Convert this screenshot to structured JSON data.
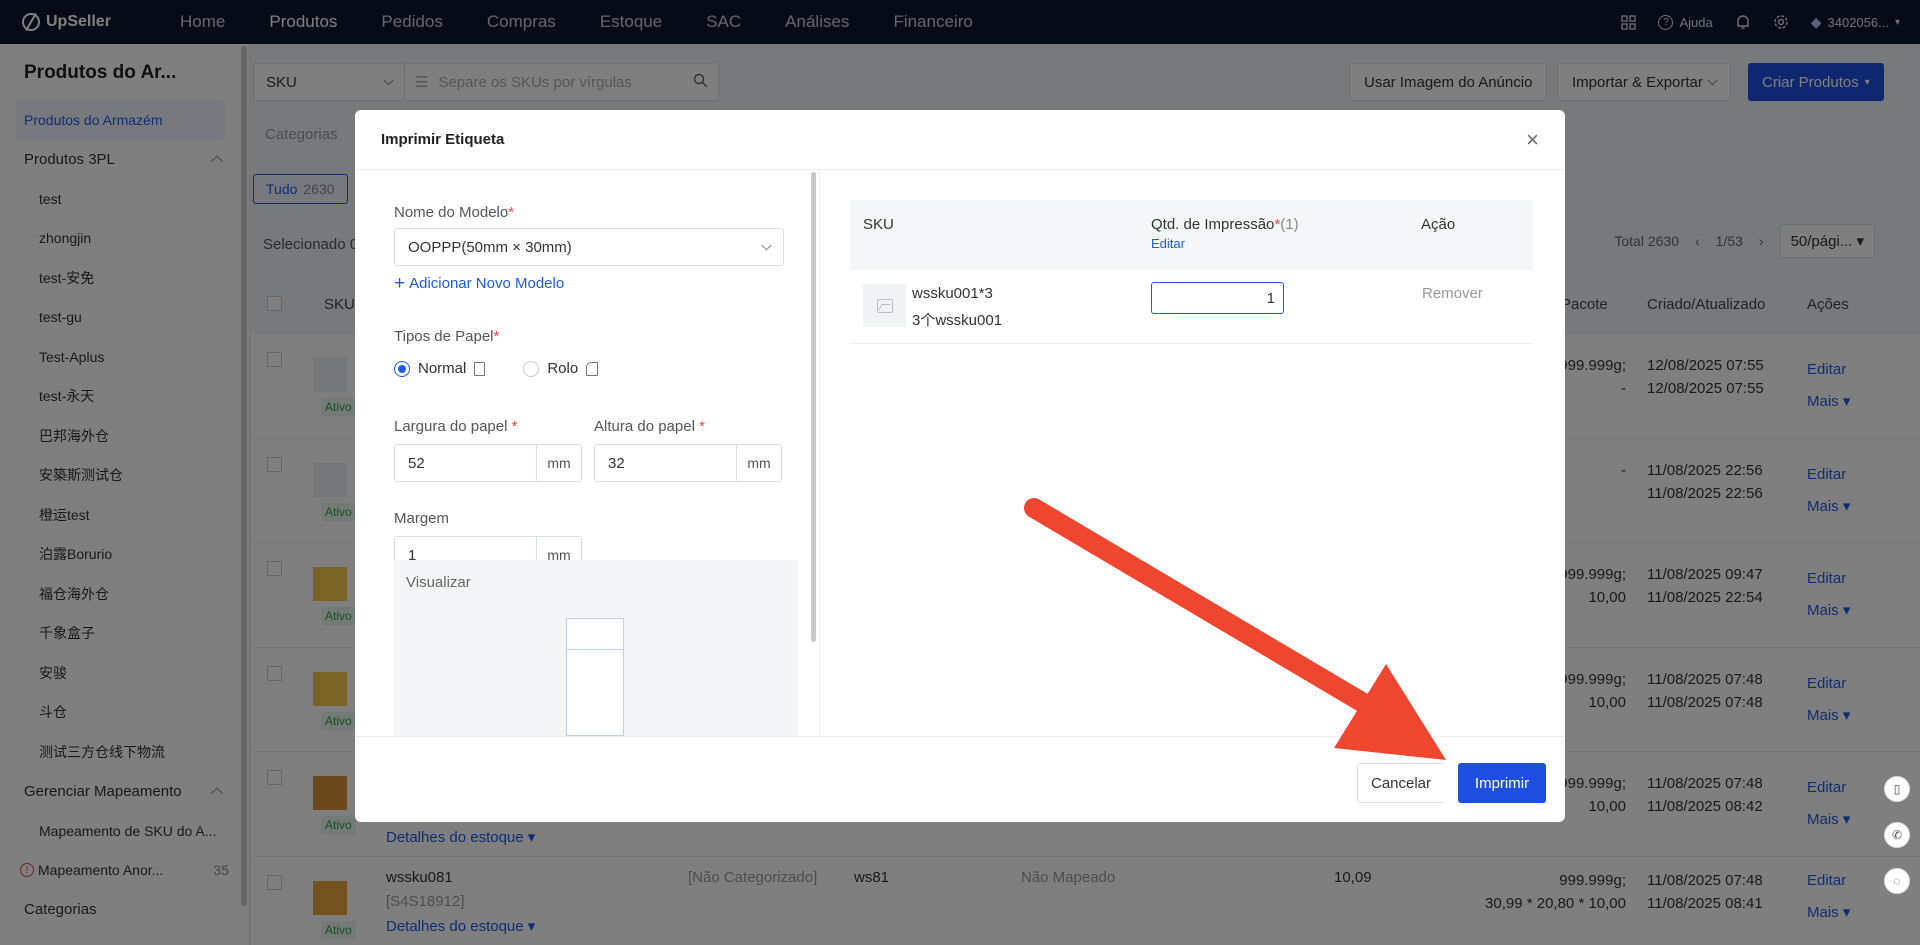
{
  "app": {
    "logo": "UpSeller",
    "nav": [
      "Home",
      "Produtos",
      "Pedidos",
      "Compras",
      "Estoque",
      "SAC",
      "Análises",
      "Financeiro"
    ],
    "active_nav": "Produtos",
    "help": "Ajuda",
    "account": "3402056..."
  },
  "sidebar": {
    "title": "Produtos do Ar...",
    "items": [
      {
        "label": "Produtos do Armazém"
      },
      {
        "label": "Produtos 3PL"
      },
      {
        "label": "test"
      },
      {
        "label": "zhongjin"
      },
      {
        "label": "test-安免"
      },
      {
        "label": "test-gu"
      },
      {
        "label": "Test-Aplus"
      },
      {
        "label": "test-永天"
      },
      {
        "label": "巴邦海外仓"
      },
      {
        "label": "安築斯测试仓"
      },
      {
        "label": "橙运test"
      },
      {
        "label": "泊露Borurio"
      },
      {
        "label": "福仓海外仓"
      },
      {
        "label": "千象盒子"
      },
      {
        "label": "安骏"
      },
      {
        "label": "斗仓"
      },
      {
        "label": "测试三方仓线下物流"
      },
      {
        "label": "Gerenciar Mapeamento"
      },
      {
        "label": "Mapeamento de SKU do A..."
      },
      {
        "label": "Mapeamento Anor...",
        "count": "35"
      },
      {
        "label": "Categorias"
      }
    ]
  },
  "toolbar": {
    "sku_select": "SKU",
    "sku_placeholder": "Separe os SKUs por vírgulas",
    "btn_image": "Usar Imagem do Anúncio",
    "btn_import": "Importar & Exportar",
    "btn_create": "Criar Produtos",
    "categories_placeholder": "Categorias"
  },
  "list": {
    "tab_all": "Tudo",
    "tab_all_count": "2630",
    "selected_text": "Selecionado 0",
    "total": "Total 2630",
    "page": "1/53",
    "per_page": "50/pági...",
    "col_sku": "SKU",
    "col_pacote": "Pacote",
    "col_dates": "Criado/Atualizado",
    "col_actions": "Ações",
    "status_active": "Ativo",
    "action_edit": "Editar",
    "action_more": "Mais",
    "rows": [
      {
        "dim1": "999.999g;",
        "dim2": "-",
        "d1": "12/08/2025 07:55",
        "d2": "12/08/2025 07:55"
      },
      {
        "dim1": "-",
        "dim2": "",
        "d1": "11/08/2025 22:56",
        "d2": "11/08/2025 22:56"
      },
      {
        "dim1": "999.999g;",
        "dim2": "10,00",
        "d1": "11/08/2025 09:47",
        "d2": "11/08/2025 22:54"
      },
      {
        "dim1": "999.999g;",
        "dim2": "10,00",
        "d1": "11/08/2025 07:48",
        "d2": "11/08/2025 07:48"
      },
      {
        "dim1": "999.999g;",
        "dim2": "10,00",
        "d1": "11/08/2025 07:48",
        "d2": "11/08/2025 08:42"
      },
      {
        "dim1": "999.999g;",
        "dim2": "30,99 * 20,80 * 10,00",
        "d1": "11/08/2025 07:48",
        "d2": "11/08/2025 08:41"
      }
    ],
    "row6": {
      "sku": "wssku081",
      "code": "[S4S18912]",
      "stock_link": "Detalhes do estoque",
      "category": "[Não Categorizado]",
      "ref": "ws81",
      "mapping": "Não Mapeado",
      "price": "10,09"
    },
    "row5_stock_link": "Detalhes do estoque"
  },
  "modal": {
    "title": "Imprimir Etiqueta",
    "model_label": "Nome do Modelo",
    "model_value": "OOPPP(50mm × 30mm)",
    "add_model": "Adicionar Novo Modelo",
    "paper_type_label": "Tipos de Papel",
    "paper_normal": "Normal",
    "paper_roll": "Rolo",
    "width_label": "Largura do papel",
    "width_value": "52",
    "height_label": "Altura do papel",
    "height_value": "32",
    "margin_label": "Margem",
    "margin_value": "1",
    "unit": "mm",
    "preview_label": "Visualizar",
    "table": {
      "col_sku": "SKU",
      "col_qty": "Qtd. de Impressão",
      "col_qty_count": "(1)",
      "col_qty_edit": "Editar",
      "col_action": "Ação",
      "rows": [
        {
          "sku": "wssku001*3",
          "name": "3个wssku001",
          "qty": "1",
          "action": "Remover"
        }
      ]
    },
    "cancel": "Cancelar",
    "print": "Imprimir"
  },
  "colors": {
    "primary": "#1f4fe0",
    "nav_bg": "#0b1830",
    "annotation_arrow": "#ef4630"
  }
}
